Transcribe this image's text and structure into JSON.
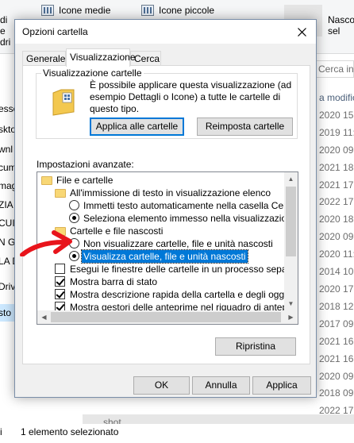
{
  "background": {
    "ribbon": {
      "items": [
        {
          "label": "Icone medie"
        },
        {
          "label": "Icone piccole"
        }
      ],
      "right_label_line1": "Nasco",
      "right_label_line2": "sel",
      "edge_labels": [
        "di",
        "e",
        "dri"
      ]
    },
    "search_placeholder": "Cerca in",
    "left_pane_items": [
      "essc",
      "skto",
      "wnl",
      "cum",
      "mag",
      "ZIA",
      "CUI",
      "N GI",
      "LA D",
      "Driv",
      "sto F"
    ],
    "right_column": {
      "header": "a modific",
      "dates": [
        "2020 15:",
        "2019 11:0",
        "2020 09:",
        "2021 18:",
        "2021 17:",
        "2022 17:",
        "2020 18:",
        "2020 09:",
        "2020 11:",
        "2014 10:",
        "2020 17:",
        "2018 12:",
        "2017 09:",
        "2021 16:",
        "2021 16:",
        "2020 09:",
        "2018 09:",
        "2022 17:"
      ]
    },
    "file_name": "shot",
    "status_text": "1 elemento selezionato",
    "status_edge": "i"
  },
  "dialog": {
    "title": "Opzioni cartella",
    "tabs": [
      {
        "label": "Generale",
        "active": false
      },
      {
        "label": "Visualizzazione",
        "active": true
      },
      {
        "label": "Cerca",
        "active": false
      }
    ],
    "folder_views": {
      "legend": "Visualizzazione cartelle",
      "description": "È possibile applicare questa visualizzazione (ad esempio Dettagli o Icone) a tutte le cartelle di questo tipo.",
      "apply_button": "Applica alle cartelle",
      "reset_button": "Reimposta cartelle"
    },
    "advanced_label": "Impostazioni avanzate:",
    "tree": [
      {
        "kind": "folder",
        "level": 0,
        "label": "File e cartelle"
      },
      {
        "kind": "folder",
        "level": 1,
        "label": "All'immissione di testo in visualizzazione elenco"
      },
      {
        "kind": "radio",
        "level": 2,
        "checked": false,
        "label": "Immetti testo automaticamente nella casella Cerca"
      },
      {
        "kind": "radio",
        "level": 2,
        "checked": true,
        "label": "Seleziona elemento immesso nella visualizzazione"
      },
      {
        "kind": "folder",
        "level": 1,
        "label": "Cartelle e file nascosti"
      },
      {
        "kind": "radio",
        "level": 2,
        "checked": false,
        "label": "Non visualizzare cartelle, file e unità nascosti"
      },
      {
        "kind": "radio",
        "level": 2,
        "checked": true,
        "selected": true,
        "label": "Visualizza cartelle, file e unità nascosti"
      },
      {
        "kind": "checkbox",
        "level": 1,
        "checked": false,
        "label": "Esegui le finestre delle cartelle in un processo separato"
      },
      {
        "kind": "checkbox",
        "level": 1,
        "checked": true,
        "label": "Mostra barra di stato"
      },
      {
        "kind": "checkbox",
        "level": 1,
        "checked": true,
        "label": "Mostra descrizione rapida della cartella e degli oggetti del"
      },
      {
        "kind": "checkbox",
        "level": 1,
        "checked": true,
        "label": "Mostra gestori delle anteprime nel riquadro di anteprima"
      }
    ],
    "restore_button": "Ripristina",
    "footer": {
      "ok": "OK",
      "cancel": "Annulla",
      "apply": "Applica"
    },
    "colors": {
      "accent": "#0078d7",
      "annotation_arrow": "#e8141b"
    }
  }
}
